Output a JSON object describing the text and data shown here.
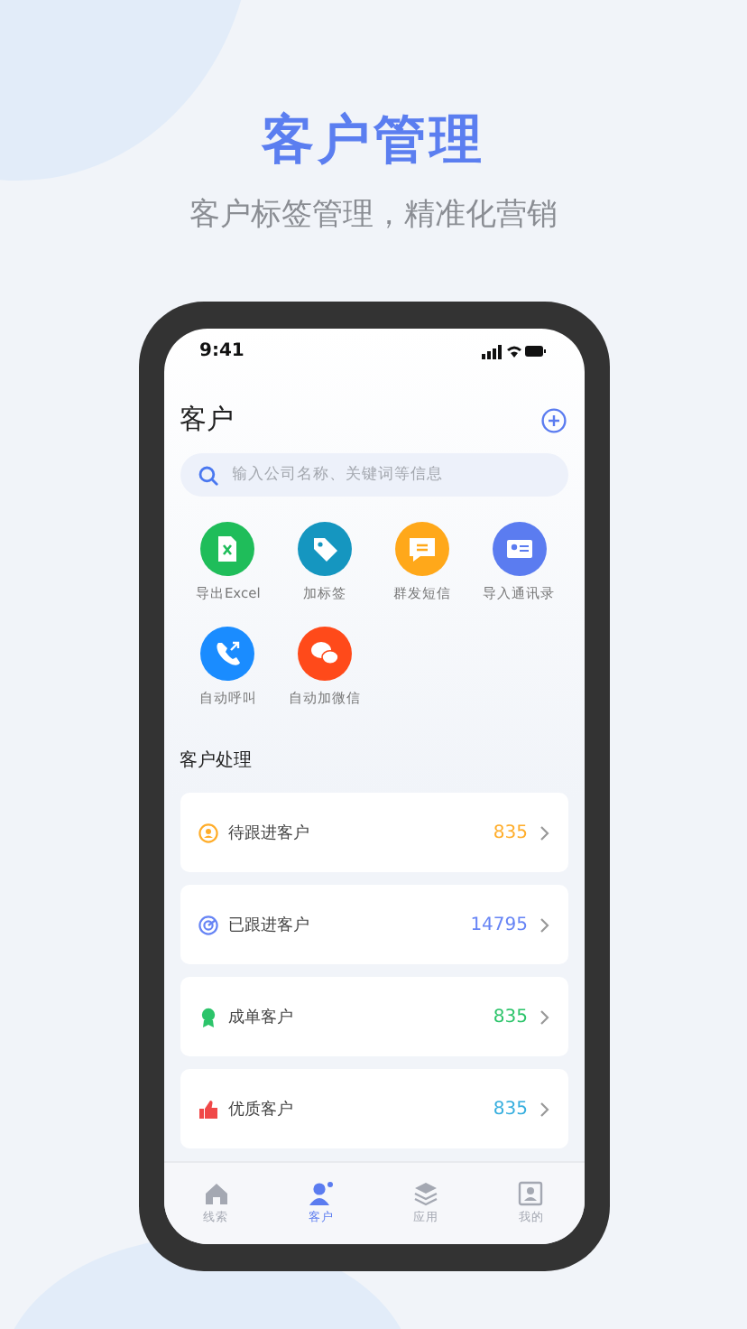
{
  "headline": {
    "title": "客户管理",
    "subtitle": "客户标签管理，精准化营销"
  },
  "status_bar": {
    "time": "9:41"
  },
  "header": {
    "title": "客户"
  },
  "search": {
    "placeholder": "输入公司名称、关键词等信息"
  },
  "actions": [
    {
      "label": "导出Excel",
      "kind": "excel",
      "color": "#1fbd5a"
    },
    {
      "label": "加标签",
      "kind": "tag",
      "color": "#1596c0"
    },
    {
      "label": "群发短信",
      "kind": "sms",
      "color": "#ffa81a"
    },
    {
      "label": "导入通讯录",
      "kind": "contact",
      "color": "#5b7cf0"
    },
    {
      "label": "自动呼叫",
      "kind": "call",
      "color": "#1a8cff"
    },
    {
      "label": "自动加微信",
      "kind": "wechat",
      "color": "#ff4a1a"
    }
  ],
  "section": {
    "title": "客户处理"
  },
  "rows": [
    {
      "label": "待跟进客户",
      "count": "835",
      "kind": "person",
      "color": "#ffad2a"
    },
    {
      "label": "已跟进客户",
      "count": "14795",
      "kind": "target",
      "color": "#6684f5"
    },
    {
      "label": "成单客户",
      "count": "835",
      "kind": "medal",
      "color": "#2cc46a"
    },
    {
      "label": "优质客户",
      "count": "835",
      "kind": "thumb",
      "color": "#36aede"
    }
  ],
  "tabs": [
    {
      "label": "线索",
      "kind": "home",
      "selected": false
    },
    {
      "label": "客户",
      "kind": "user",
      "selected": true
    },
    {
      "label": "应用",
      "kind": "layers",
      "selected": false
    },
    {
      "label": "我的",
      "kind": "profile",
      "selected": false
    }
  ]
}
